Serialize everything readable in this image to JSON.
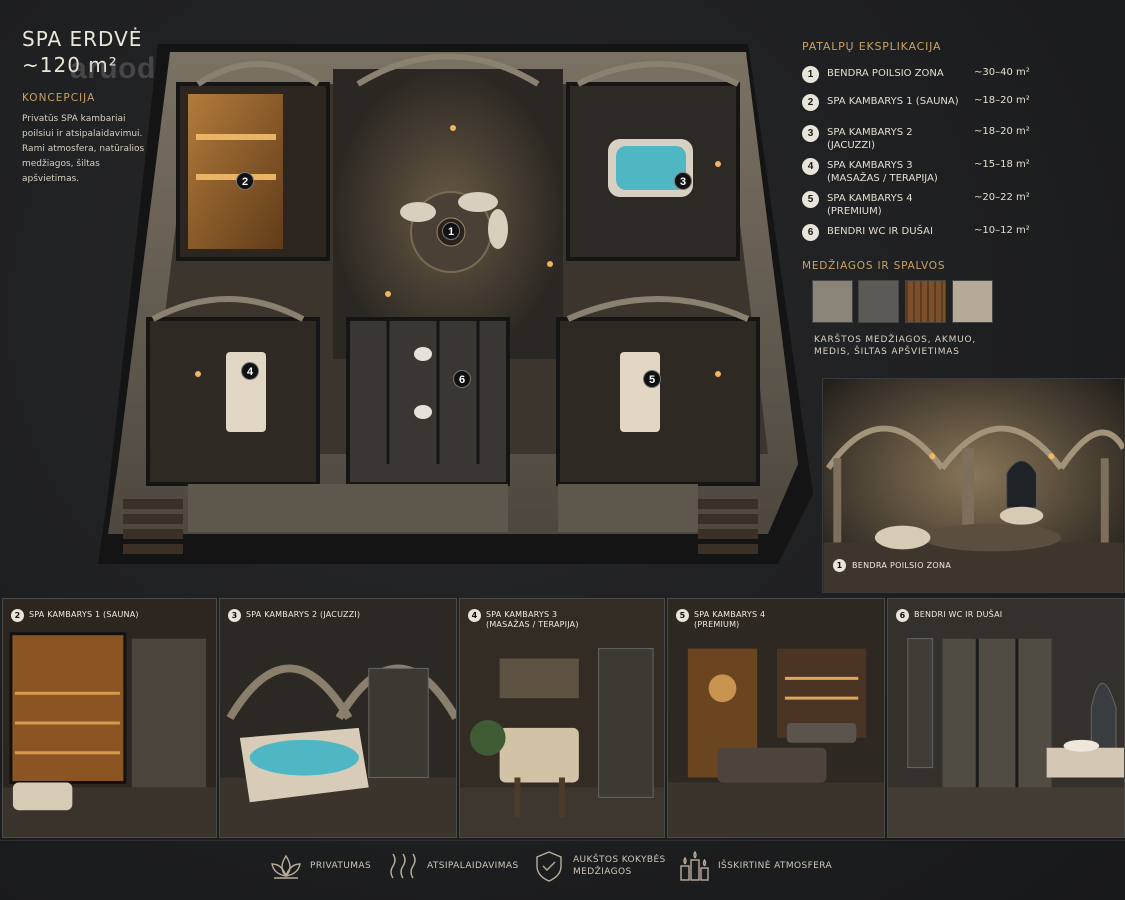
{
  "header": {
    "title_line1": "SPA ERDVĖ",
    "title_line2": "~120 m²",
    "watermark": "aruodas.lt"
  },
  "concept": {
    "heading": "KONCEPCIJA",
    "text": "Privatūs SPA kambariai poilsiui ir atsipalaidavimui. Rami atmosfera, natūralios medžiagos, šiltas apšvietimas."
  },
  "plan": {
    "markers": [
      "1",
      "2",
      "3",
      "4",
      "5",
      "6"
    ]
  },
  "legend": {
    "heading": "PATALPŲ EKSPLIKACIJA",
    "rooms": [
      {
        "num": "1",
        "name": "BENDRA POILSIO ZONA",
        "area": "~30–40 m²"
      },
      {
        "num": "2",
        "name": "SPA KAMBARYS 1 (SAUNA)",
        "area": "~18–20 m²"
      },
      {
        "num": "3",
        "name": "SPA KAMBARYS 2 (JACUZZI)",
        "area": "~18–20 m²"
      },
      {
        "num": "4",
        "name": "SPA KAMBARYS 3 (MASAŽAS / TERAPIJA)",
        "area": "~15–18 m²"
      },
      {
        "num": "5",
        "name": "SPA KAMBARYS 4 (PREMIUM)",
        "area": "~20–22 m²"
      },
      {
        "num": "6",
        "name": "BENDRI WC IR DUŠAI",
        "area": "~10–12 m²"
      }
    ]
  },
  "materials": {
    "heading": "MEDŽIAGOS IR SPALVOS",
    "swatches": [
      "#8a8478",
      "#5c5a55",
      "#7a4f2a",
      "#b5aa98"
    ],
    "text": "KARŠTOS MEDŽIAGOS, AKMUO, MEDIS, ŠILTAS APŠVIETIMAS"
  },
  "lounge_photo": {
    "num": "1",
    "caption": "BENDRA POILSIO ZONA"
  },
  "photos": [
    {
      "num": "2",
      "line1": "SPA KAMBARYS 1 (SAUNA)",
      "line2": ""
    },
    {
      "num": "3",
      "line1": "SPA KAMBARYS 2 (JACUZZI)",
      "line2": ""
    },
    {
      "num": "4",
      "line1": "SPA KAMBARYS 3",
      "line2": "(MASAŽAS / TERAPIJA)"
    },
    {
      "num": "5",
      "line1": "SPA KAMBARYS 4",
      "line2": "(PREMIUM)"
    },
    {
      "num": "6",
      "line1": "BENDRI WC IR DUŠAI",
      "line2": ""
    }
  ],
  "features": [
    {
      "icon": "lotus-icon",
      "label": "PRIVATUMAS"
    },
    {
      "icon": "steam-waves-icon",
      "label": "ATSIPALAIDAVIMAS"
    },
    {
      "icon": "shield-check-icon",
      "label": "AUKŠTOS KOKYBĖS MEDŽIAGOS"
    },
    {
      "icon": "candles-icon",
      "label": "IŠSKIRTINĖ ATMOSFERA"
    }
  ],
  "colors": {
    "accent": "#c9a064",
    "background": "#1e1f21",
    "stone": "#6e6658",
    "warm_light": "#e0a75a",
    "water": "#4fb7c4"
  }
}
